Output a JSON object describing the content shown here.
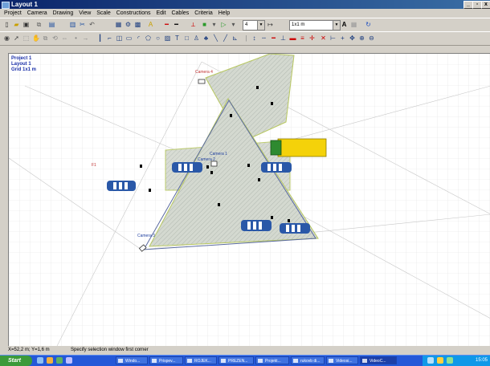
{
  "window": {
    "title": "Layout 1"
  },
  "menu": [
    "Project",
    "Camera",
    "Drawing",
    "View",
    "Scale",
    "Constructions",
    "Edit",
    "Cables",
    "Criteria",
    "Help"
  ],
  "toolbar": {
    "page_field": "4",
    "scale_field": "1x1 m",
    "font_icon": "A"
  },
  "canvas": {
    "info_lines": [
      "Project 1",
      "Layout 1",
      "Grid 1x1 m"
    ],
    "camera_labels": [
      "Camera 1",
      "Camera 2",
      "Camera 3",
      "Camera 4"
    ],
    "point_label": "F1"
  },
  "status": {
    "coords": "X=52,2 m; Y=1,6 m",
    "message": "Specify selection window first corner"
  },
  "taskbar": {
    "start_label": "Start",
    "tasks": [
      "Windo...",
      "Prispev...",
      "ROJEK...",
      "PREZEN...",
      "Projekt...",
      "rukovb di...",
      "Videosi...",
      "VideoC..."
    ],
    "clock": "15:05"
  },
  "colors": {
    "title_bar": "#0a246a",
    "camera_zone": "#c4ccc0",
    "camera_edge": "#b8c860",
    "fov_line": "#5a6aa0",
    "car_blue": "#2a58a8",
    "truck_yellow": "#f4d20a",
    "truck_green": "#2e8a30"
  }
}
